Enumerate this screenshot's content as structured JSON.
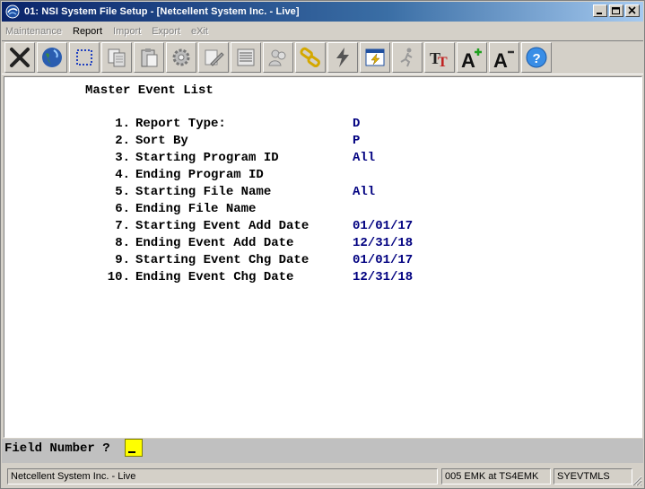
{
  "window": {
    "title": "01: NSI System File Setup - [Netcellent System Inc. - Live]"
  },
  "menu": [
    {
      "label": "Maintenance",
      "enabled": false
    },
    {
      "label": "Report",
      "enabled": true
    },
    {
      "label": "Import",
      "enabled": false
    },
    {
      "label": "Export",
      "enabled": false
    },
    {
      "label": "eXit",
      "enabled": false
    }
  ],
  "toolbar": [
    {
      "icon": "close-x-icon"
    },
    {
      "icon": "globe-icon"
    },
    {
      "icon": "select-rectangle-icon"
    },
    {
      "icon": "copy-icon"
    },
    {
      "icon": "paste-icon"
    },
    {
      "icon": "gear-icon"
    },
    {
      "icon": "edit-icon"
    },
    {
      "icon": "list-icon"
    },
    {
      "icon": "users-icon"
    },
    {
      "icon": "link-icon"
    },
    {
      "icon": "lightning-icon"
    },
    {
      "icon": "calendar-lightning-icon"
    },
    {
      "icon": "run-icon"
    },
    {
      "icon": "font-tt-icon"
    },
    {
      "icon": "font-increase-icon"
    },
    {
      "icon": "font-decrease-icon"
    },
    {
      "icon": "help-icon"
    }
  ],
  "screen": {
    "title": "Master Event List",
    "fields": [
      {
        "num": "1.",
        "label": "Report Type:",
        "value": "D"
      },
      {
        "num": "2.",
        "label": "Sort By",
        "value": "P"
      },
      {
        "num": "3.",
        "label": "Starting Program ID",
        "value": "All"
      },
      {
        "num": "4.",
        "label": "Ending Program ID",
        "value": ""
      },
      {
        "num": "5.",
        "label": "Starting File Name",
        "value": "All"
      },
      {
        "num": "6.",
        "label": "Ending File Name",
        "value": ""
      },
      {
        "num": "7.",
        "label": "Starting Event Add Date",
        "value": "01/01/17"
      },
      {
        "num": "8.",
        "label": "Ending Event Add Date",
        "value": "12/31/18"
      },
      {
        "num": "9.",
        "label": "Starting Event Chg Date",
        "value": "01/01/17"
      },
      {
        "num": "10.",
        "label": "Ending Event Chg Date",
        "value": "12/31/18"
      }
    ]
  },
  "prompt": {
    "label": "Field Number ?",
    "value": ""
  },
  "status": {
    "company": "Netcellent System Inc. - Live",
    "session": "005 EMK at TS4EMK",
    "program": "SYEVTMLS"
  },
  "colors": {
    "title_bar": "#0a246a",
    "field_value": "#000080",
    "prompt_input": "#ffff00"
  }
}
